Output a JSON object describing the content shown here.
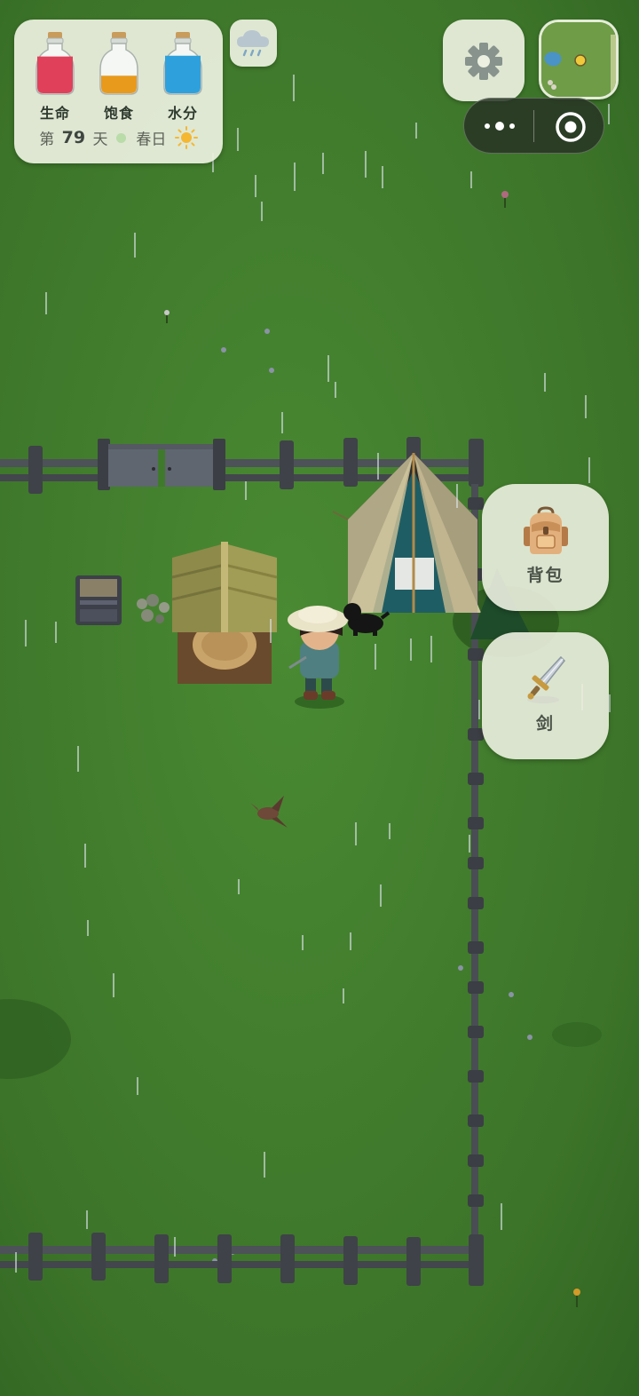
{
  "hud": {
    "stats": [
      {
        "label": "生命",
        "level": 0.88,
        "color": "#e0405a"
      },
      {
        "label": "饱食",
        "level": 0.42,
        "color": "#e89a1c"
      },
      {
        "label": "水分",
        "level": 0.9,
        "color": "#2ea1dd"
      }
    ],
    "day_prefix": "第",
    "day_number": "79",
    "day_suffix": "天",
    "season": "春日",
    "weather_icon": "rain-cloud-icon",
    "time_icon": "sun-icon"
  },
  "top_right": {
    "settings_icon": "gear-icon",
    "minimap_icon": "minimap",
    "capsule_icons": [
      "more-dots-icon",
      "close-target-icon"
    ]
  },
  "actions": {
    "backpack_label": "背包",
    "backpack_icon": "backpack-icon",
    "sword_label": "剑",
    "sword_icon": "sword-icon"
  },
  "colors": {
    "grass": "#3f7a2c",
    "panel": "#ecf0e0",
    "fence": "#46494f"
  }
}
